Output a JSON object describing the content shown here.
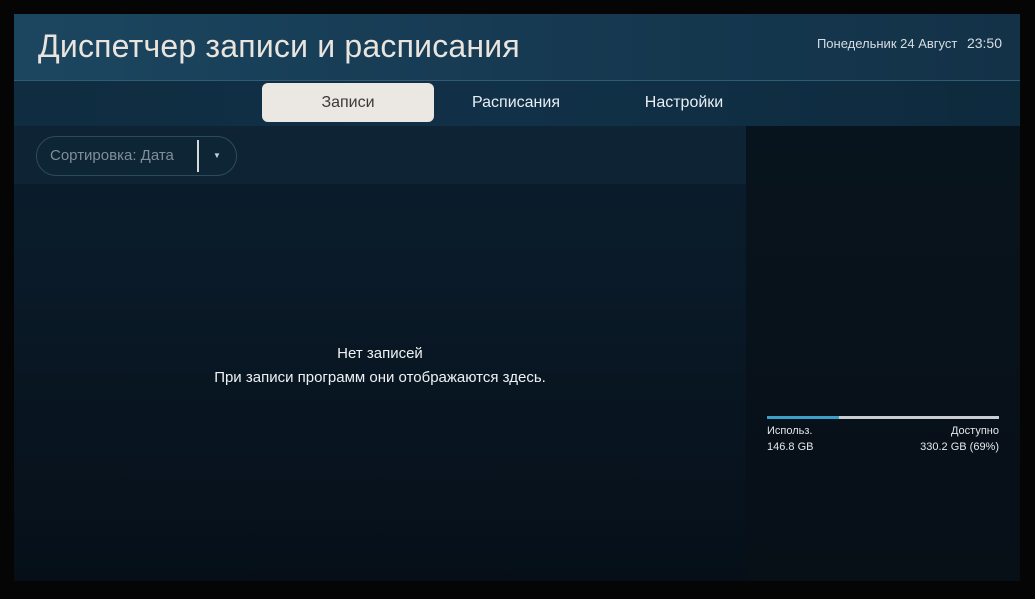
{
  "header": {
    "title": "Диспетчер записи и расписания",
    "day": "Понедельник 24 Август",
    "time": "23:50"
  },
  "tabs": [
    {
      "label": "Записи",
      "active": true
    },
    {
      "label": "Расписания",
      "active": false
    },
    {
      "label": "Настройки",
      "active": false
    }
  ],
  "sort": {
    "label": "Сортировка: Дата",
    "caret_icon": "caret-down-icon"
  },
  "empty_state": {
    "title": "Нет записей",
    "subtitle": "При записи программ они отображаются здесь."
  },
  "storage": {
    "used_label": "Использ.",
    "used_value": "146.8 GB",
    "free_label": "Доступно",
    "free_value": "330.2 GB (69%)",
    "used_fraction": 0.31
  },
  "colors": {
    "active_tab_bg": "#ebe7e3",
    "storage_fill": "#3aa0c8"
  }
}
